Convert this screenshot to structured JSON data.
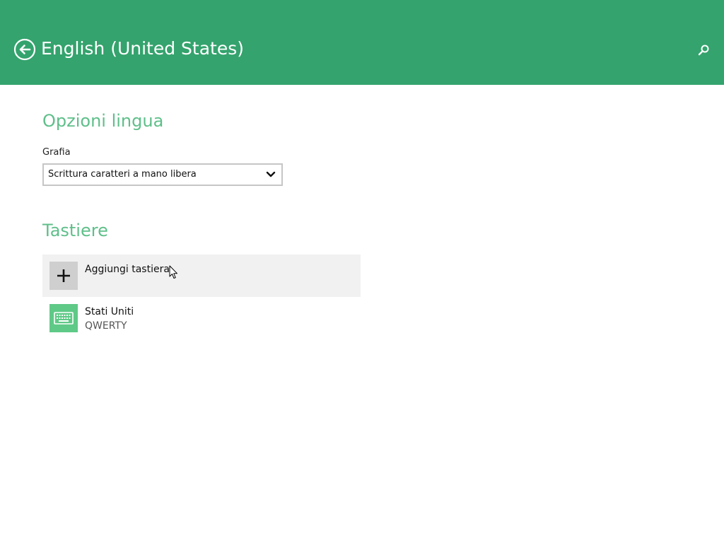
{
  "header": {
    "title": "English (United States)",
    "back_icon": "back-arrow-icon",
    "search_icon": "search-icon",
    "background_color": "#34a36d"
  },
  "language_options": {
    "section_title": "Opzioni lingua",
    "handwriting": {
      "label": "Grafia",
      "selected_value": "Scrittura caratteri a mano libera"
    }
  },
  "keyboards": {
    "section_title": "Tastiere",
    "add": {
      "label": "Aggiungi tastiera",
      "icon": "plus-icon"
    },
    "items": [
      {
        "title": "Stati Uniti",
        "subtitle": "QWERTY",
        "icon": "keyboard-icon",
        "tile_color": "#5fc987"
      }
    ]
  },
  "accent_color": "#5fbf8a"
}
